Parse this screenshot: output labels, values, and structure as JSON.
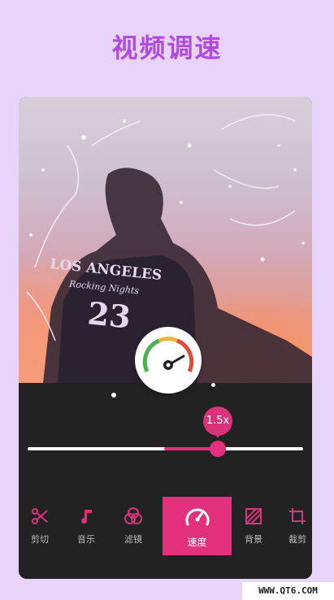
{
  "headline": "视频调速",
  "photo": {
    "jersey_line1": "LOS ANGELES",
    "jersey_line2": "Rocking Nights",
    "jersey_number": "23"
  },
  "speed": {
    "value_label": "1.5x",
    "slider_value": 0.69
  },
  "toolbar": {
    "items": [
      {
        "label": "剪切",
        "icon": "scissors-icon",
        "active": false
      },
      {
        "label": "音乐",
        "icon": "music-note-icon",
        "active": false
      },
      {
        "label": "滤镜",
        "icon": "filter-circles-icon",
        "active": false
      },
      {
        "label": "速度",
        "icon": "speedometer-icon",
        "active": true
      },
      {
        "label": "背景",
        "icon": "background-pattern-icon",
        "active": false
      },
      {
        "label": "裁剪",
        "icon": "crop-icon",
        "active": false
      }
    ]
  },
  "watermark": "WWW.QT6.COM",
  "colors": {
    "page_bg": "#e8d3fb",
    "headline": "#b04bdf",
    "accent": "#e2307d",
    "panel": "#222222"
  }
}
